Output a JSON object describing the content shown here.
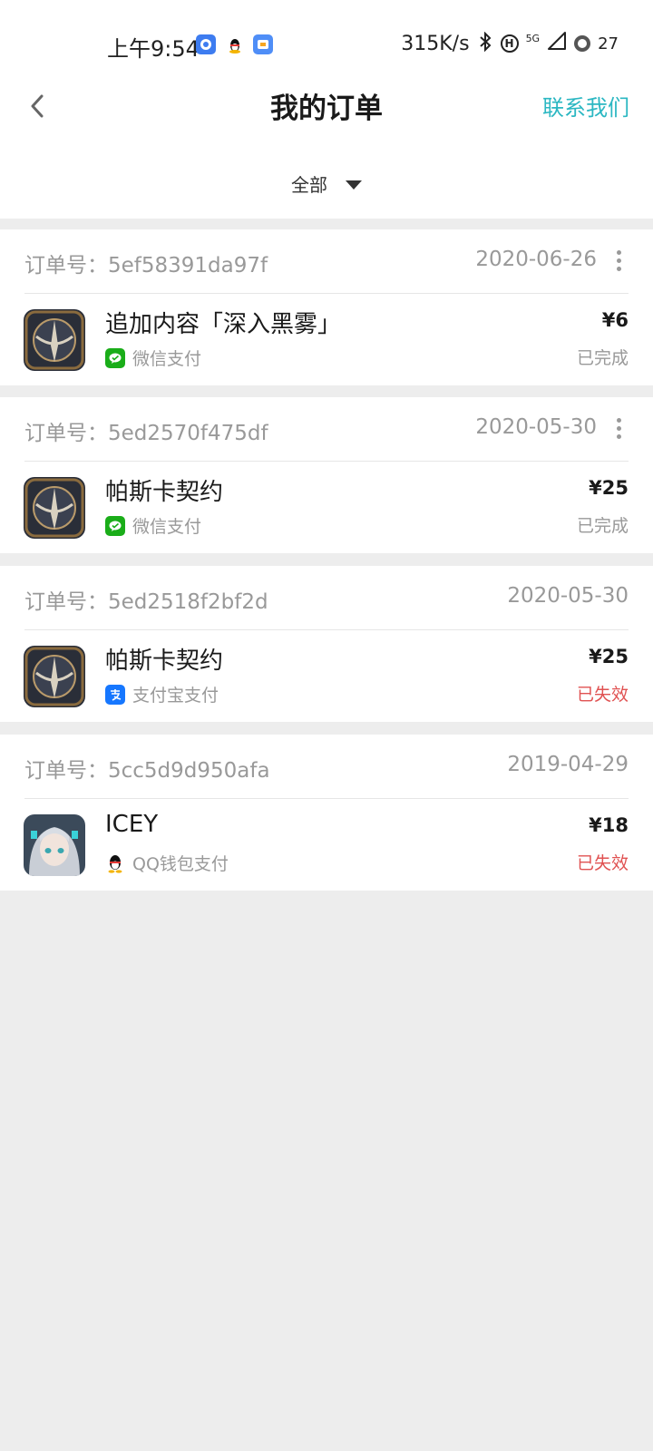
{
  "status_bar": {
    "time": "上午9:54",
    "speed": "315K/s",
    "battery": "27",
    "network": "5G"
  },
  "header": {
    "title": "我的订单",
    "contact": "联系我们",
    "back_icon": "chevron-left-icon"
  },
  "filter": {
    "label": "全部"
  },
  "orders": [
    {
      "order_label": "订单号：5ef58391da97f",
      "date": "2020-06-26",
      "name": "追加内容「深入黑雾」",
      "payment": "微信支付",
      "payment_icon": "wechat-pay-icon",
      "price": "¥6",
      "status": "已完成",
      "status_type": "done",
      "has_more": true
    },
    {
      "order_label": "订单号：5ed2570f475df",
      "date": "2020-05-30",
      "name": "帕斯卡契约",
      "payment": "微信支付",
      "payment_icon": "wechat-pay-icon",
      "price": "¥25",
      "status": "已完成",
      "status_type": "done",
      "has_more": true
    },
    {
      "order_label": "订单号：5ed2518f2bf2d",
      "date": "2020-05-30",
      "name": "帕斯卡契约",
      "payment": "支付宝支付",
      "payment_icon": "alipay-icon",
      "price": "¥25",
      "status": "已失效",
      "status_type": "failed",
      "has_more": false
    },
    {
      "order_label": "订单号：5cc5d9d950afa",
      "date": "2019-04-29",
      "name": "ICEY",
      "payment": "QQ钱包支付",
      "payment_icon": "qq-wallet-icon",
      "price": "¥18",
      "status": "已失效",
      "status_type": "failed",
      "has_more": false
    }
  ],
  "colors": {
    "accent": "#2bb7c2",
    "failed": "#e05252",
    "muted": "#999999",
    "background": "#ededed"
  }
}
